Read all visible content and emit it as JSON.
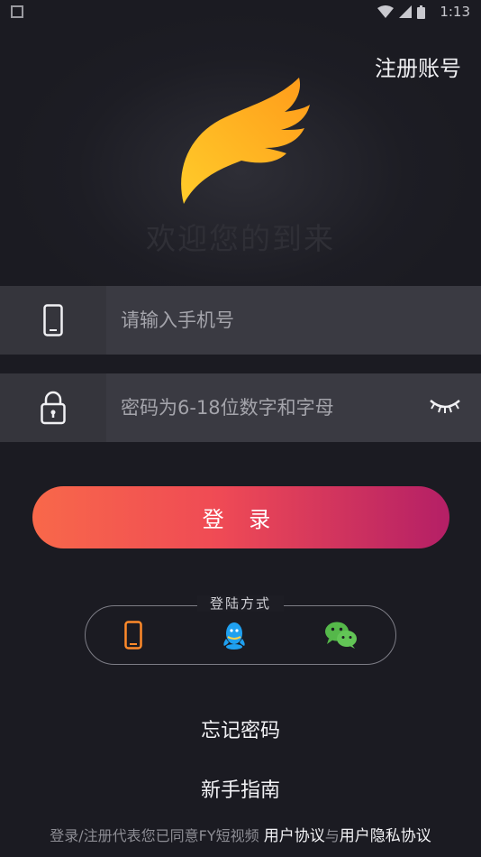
{
  "status_bar": {
    "time": "1:13"
  },
  "header": {
    "register_label": "注册账号"
  },
  "welcome_text": "欢迎您的到来",
  "phone_field": {
    "placeholder": "请输入手机号",
    "value": ""
  },
  "password_field": {
    "placeholder": "密码为6-18位数字和字母",
    "value": ""
  },
  "login_button": {
    "label": "登 录"
  },
  "login_methods": {
    "title": "登陆方式",
    "icons": [
      "phone-icon",
      "qq-icon",
      "wechat-icon"
    ]
  },
  "links": {
    "forgot_password": "忘记密码",
    "beginner_guide": "新手指南"
  },
  "terms": {
    "prefix": "登录/注册代表您已同意FY短视频 ",
    "user_agreement": "用户协议",
    "connector": "与",
    "privacy_agreement": "用户隐私协议"
  },
  "colors": {
    "background": "#1d1d24",
    "field": "#3a3a42",
    "button_start": "#f8684a",
    "button_end": "#b41f66",
    "logo": "#ffb323"
  }
}
